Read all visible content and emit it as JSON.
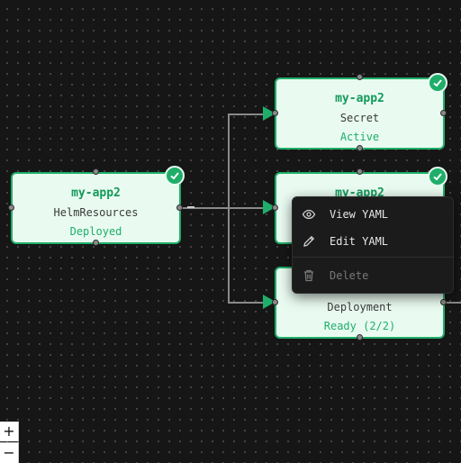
{
  "colors": {
    "canvas": "#161616",
    "node_bg": "#e9fbf1",
    "accent": "#1fae6a",
    "edge": "#8a8a8a"
  },
  "nodes": [
    {
      "id": "helm",
      "title": "my-app2",
      "type": "HelmResources",
      "status": "Deployed",
      "checked": true
    },
    {
      "id": "secret",
      "title": "my-app2",
      "type": "Secret",
      "status": "Active",
      "checked": true
    },
    {
      "id": "mid",
      "title": "my-app2",
      "type": "",
      "status": "",
      "checked": true
    },
    {
      "id": "deployment",
      "title": "",
      "type": "Deployment",
      "status": "Ready (2/2)",
      "checked": false
    }
  ],
  "context_menu": {
    "items": [
      {
        "label": "View YAML",
        "icon": "eye-icon",
        "disabled": false
      },
      {
        "label": "Edit YAML",
        "icon": "pencil-icon",
        "disabled": false
      },
      {
        "label": "Delete",
        "icon": "trash-icon",
        "disabled": true
      }
    ]
  },
  "zoom_controls": {
    "zoom_in": "+",
    "zoom_out": "−"
  }
}
